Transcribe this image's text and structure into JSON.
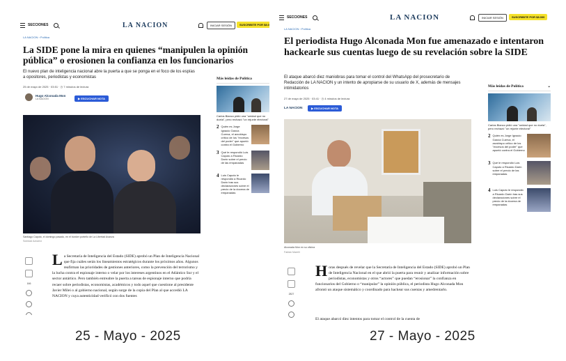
{
  "brand": "LA NACION",
  "header": {
    "sections_label": "SECCIONES",
    "login_label": "INICIAR SESIÓN",
    "subscribe_label": "SUSCRIBITE POR $8.000"
  },
  "breadcrumb": [
    "LA NACION",
    "Política"
  ],
  "left": {
    "headline": "La SIDE pone la mira en quienes “manipulen la opinión pública” o erosionen la confianza en los funcionarios",
    "dek": "El nuevo plan de inteligencia nacional abre la puerta a que se ponga en el foco de los espías a opositores, periodistas y economistas",
    "date": "25 de mayo de 2025",
    "time": "03:51",
    "read_time": "7 minutos de lectura",
    "author_name": "Hugo Alconada Mon",
    "author_org": "LA NACION",
    "follow_label": "ESCUCHAR NOTA",
    "caption": "Santiago Caputo, el domingo pasado, en el búnker porteño de La Libertad Avanza",
    "credit": "Soledad Aznarez",
    "body_drop": "L",
    "body_text": "a Secretaría de Inteligencia del Estado (SIDE) aprobó un Plan de Inteligencia Nacional que fija cuáles serán los lineamientos estratégicos durante los próximos años. Algunos reafirman las prioridades de gestiones anteriores, como la prevención del terrorismo y la lucha contra el espionaje interno o velar por los intereses argentinos en el Atlántico Sur y el sector antártico. Pero también entreabre la puerta a tareas de espionaje interno que podría recaer sobre periodistas, economistas, académicos y todo aquel que cuestione al presidente Javier Milei o al gobierno nacional, según surge de la copia del Plan al que accedió LA NACION y cuya autenticidad verificó con dos fuentes",
    "rail_count": "166",
    "sidebar": {
      "title": "Más leídas de Política",
      "first": "Carlos Bianco pidió una \"unidad que no duela\", pero rechazó \"un rejunte electoral\"",
      "items": [
        {
          "num": "2",
          "text": "Quién es Jorge Ignacio García Cuerva, el arzobispo crítico de los \"excesos del poder\" que apuntó contra el Gobierno"
        },
        {
          "num": "3",
          "text": "Qué le respondió Luis Caputo a Ricardo Darín sobre el precio de las empanadas"
        },
        {
          "num": "4",
          "text": "Luis Caputo le respondió a Ricardo Darín tras sus declaraciones sobre el precio de la docena de empanadas"
        }
      ]
    }
  },
  "right": {
    "headline": "El periodista Hugo Alconada Mon fue amenazado e intentaron hackearle sus cuentas luego de su revelación sobre la SIDE",
    "dek": "El ataque abarcó diez maniobras para tomar el control del WhatsApp del prosecretario de Redacción de LA NACION y un intento de apropiarse de su usuario de X, además de mensajes intimidatorios",
    "date": "27 de mayo de 2025",
    "time": "03:41",
    "read_time": "4 minutos de lectura",
    "author_org": "LA NACION",
    "follow_label": "ESCUCHAR NOTA",
    "caption": "Alconada Mon en su oficina",
    "credit": "Fabián Marelli",
    "body_drop": "H",
    "body_text": "oras después de revelar que la Secretaría de Inteligencia del Estado (SIDE) aprobó un Plan de Inteligencia Nacional en el que abrió la puerta para reunir y analizar información sobre periodistas, economistas y otros “actores” que puedan “erosionar” la confianza en funcionarios del Gobierno o “manipular” la opinión pública, el periodista Hugo Alconada Mon afrontó un ataque sistemático y coordinado para hackear sus cuentas y amedrentarlo.",
    "body_text2": "El ataque abarcó diez intentos para tomar el control de la cuenta de",
    "rail_count": "2827",
    "sidebar": {
      "title": "Más leídas de Política",
      "first": "Carlos Bianco pidió una \"unidad que no duela\", pero rechazó \"un rejunte electoral\"",
      "items": [
        {
          "num": "2",
          "text": "Quién es Jorge Ignacio García Cuerva, el arzobispo crítico de los \"excesos del poder\" que apuntó contra el Gobierno"
        },
        {
          "num": "3",
          "text": "Qué le respondió Luis Caputo a Ricardo Darín sobre el precio de las empanadas"
        },
        {
          "num": "4",
          "text": "Luis Caputo le respondió a Ricardo Darín tras sus declaraciones sobre el precio de la docena de empanadas"
        }
      ]
    }
  },
  "labels": {
    "left_date": "25 - Mayo - 2025",
    "right_date": "27 - Mayo - 2025"
  }
}
